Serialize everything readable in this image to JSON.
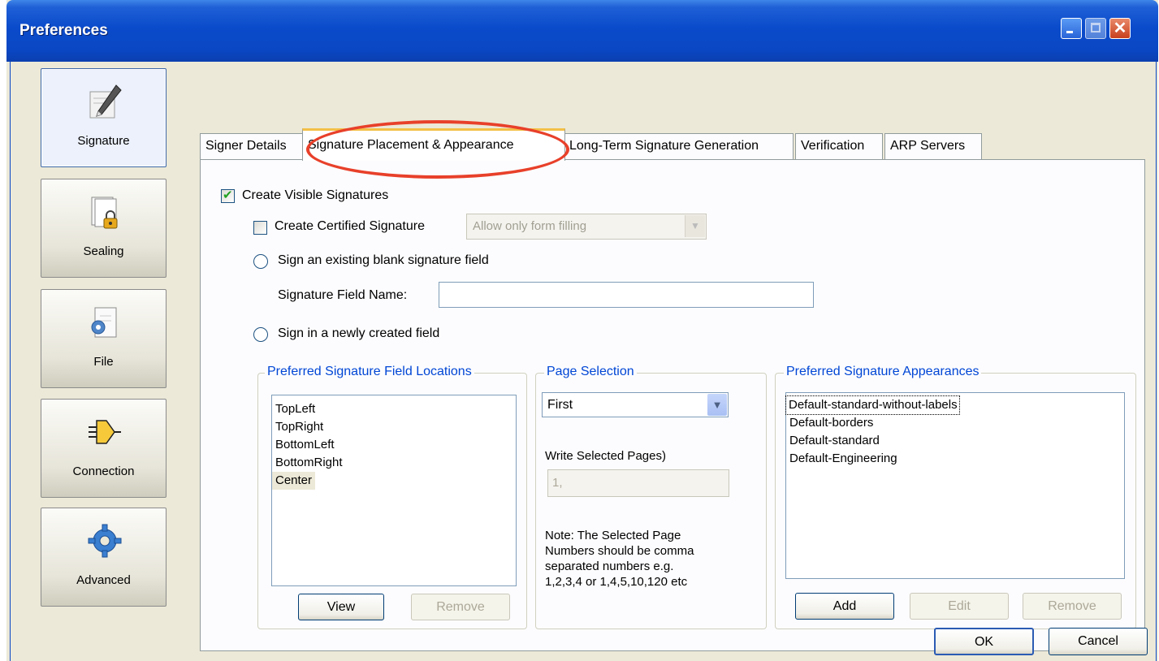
{
  "window": {
    "title": "Preferences"
  },
  "nav": {
    "items": [
      {
        "label": "Signature",
        "icon": "signature-pen-icon"
      },
      {
        "label": "Sealing",
        "icon": "document-lock-icon"
      },
      {
        "label": "File",
        "icon": "file-gear-icon"
      },
      {
        "label": "Connection",
        "icon": "plug-icon"
      },
      {
        "label": "Advanced",
        "icon": "gear-icon"
      }
    ]
  },
  "tabs": [
    {
      "label": "Signer Details"
    },
    {
      "label": "Signature Placement & Appearance"
    },
    {
      "label": "Long-Term Signature Generation"
    },
    {
      "label": "Verification"
    },
    {
      "label": "ARP Servers"
    }
  ],
  "options": {
    "create_visible": {
      "label": "Create Visible Signatures",
      "checked": true
    },
    "create_certified": {
      "label": "Create Certified Signature",
      "checked": false
    },
    "certified_select_value": "Allow only form filling",
    "sign_existing": {
      "label": "Sign an existing blank signature field",
      "checked": false
    },
    "field_name_label": "Signature Field Name:",
    "field_name_value": "",
    "sign_new": {
      "label": "Sign in a newly created field",
      "checked": true
    }
  },
  "locations": {
    "title": "Preferred Signature Field Locations",
    "items": [
      "TopLeft",
      "TopRight",
      "BottomLeft",
      "BottomRight",
      "Center"
    ],
    "selected": "Center",
    "view_label": "View",
    "remove_label": "Remove"
  },
  "page_selection": {
    "title": "Page Selection",
    "value": "First",
    "write_label": "Write Selected Pages)",
    "pages_value": "1,",
    "note_lines": [
      "Note: The Selected Page",
      "Numbers should be comma",
      "separated numbers e.g.",
      "1,2,3,4 or 1,4,5,10,120 etc"
    ]
  },
  "appearances": {
    "title": "Preferred Signature Appearances",
    "items": [
      "Default-standard-without-labels",
      "Default-borders",
      "Default-standard",
      "Default-Engineering"
    ],
    "add_label": "Add",
    "edit_label": "Edit",
    "remove_label": "Remove"
  },
  "footer": {
    "ok_label": "OK",
    "cancel_label": "Cancel"
  },
  "colors": {
    "titlebar": "#0a47c4",
    "group_title": "#0046d5",
    "annotation": "#e8402a",
    "check": "#21a121"
  }
}
